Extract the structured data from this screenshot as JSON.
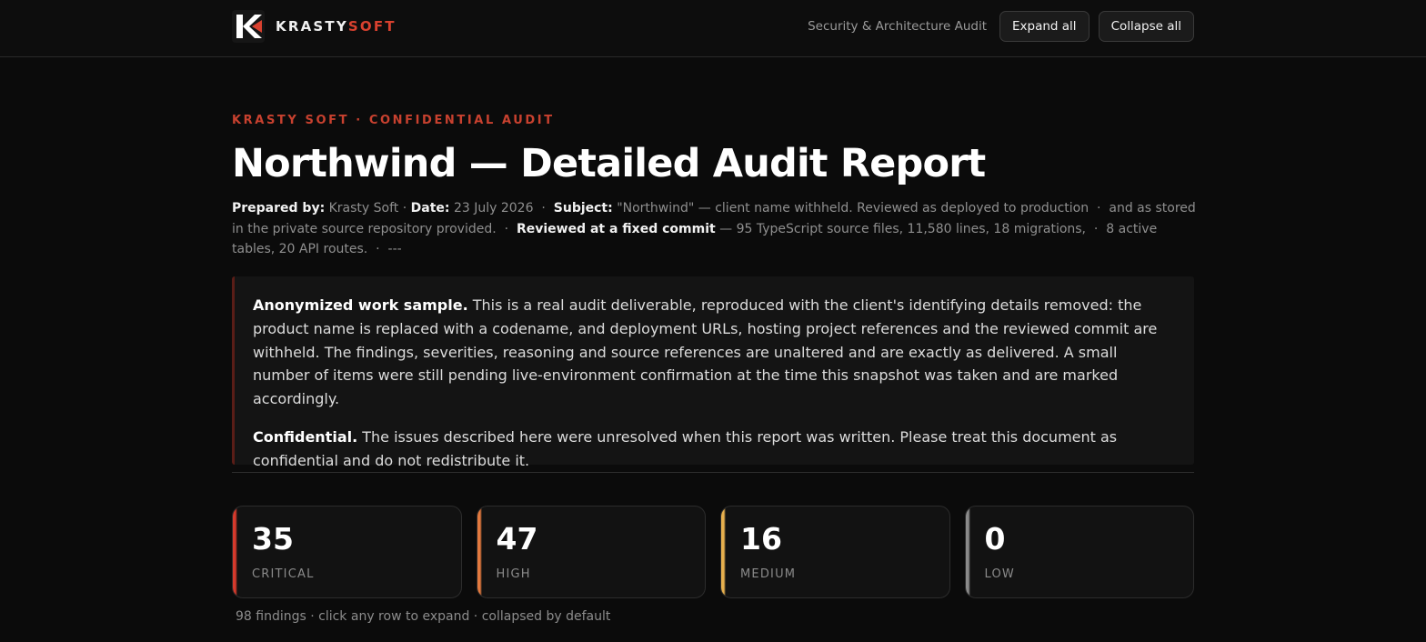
{
  "brand": {
    "name_primary": "KRASTY",
    "name_accent": "SOFT",
    "accent_color": "#d9412f",
    "logo_icon": "k-logo-icon"
  },
  "header": {
    "section_label": "Security & Architecture Audit",
    "expand_label": "Expand all",
    "collapse_label": "Collapse all"
  },
  "hero": {
    "eyebrow": "KRASTY SOFT · CONFIDENTIAL AUDIT",
    "title": "Northwind — Detailed Audit Report",
    "meta": {
      "prepared_by_label": "Prepared by:",
      "prepared_by_value": "Krasty Soft",
      "date_label": "Date:",
      "date_value": "23 July 2026",
      "subject_label": "Subject:",
      "subject_value": "\"Northwind\" — client name withheld. Reviewed as deployed to production",
      "subject_cont": "and as stored in the private source repository provided.",
      "commit_label": "Reviewed at a fixed commit",
      "commit_value": "— 95 TypeScript source files, 11,580 lines, 18 migrations,",
      "commit_cont": "8 active tables, 20 API routes.",
      "trailing": "---"
    }
  },
  "notice": {
    "p1_lead": "Anonymized work sample.",
    "p1_body": "This is a real audit deliverable, reproduced with the client's identifying details removed: the product name is replaced with a codename, and deployment URLs, hosting project references and the reviewed commit are withheld. The findings, severities, reasoning and source references are unaltered and are exactly as delivered. A small number of items were still pending live-environment confirmation at the time this snapshot was taken and are marked accordingly.",
    "p2_lead": "Confidential.",
    "p2_body": "The issues described here were unresolved when this report was written. Please treat this document as confidential and do not redistribute it."
  },
  "stats": [
    {
      "value": "35",
      "label": "CRITICAL",
      "color": "#d63a2c"
    },
    {
      "value": "47",
      "label": "HIGH",
      "color": "#e3793e"
    },
    {
      "value": "16",
      "label": "MEDIUM",
      "color": "#e7b04e"
    },
    {
      "value": "0",
      "label": "LOW",
      "color": "#8a8a8a"
    }
  ],
  "summary": "98 findings · click any row to expand · collapsed by default"
}
